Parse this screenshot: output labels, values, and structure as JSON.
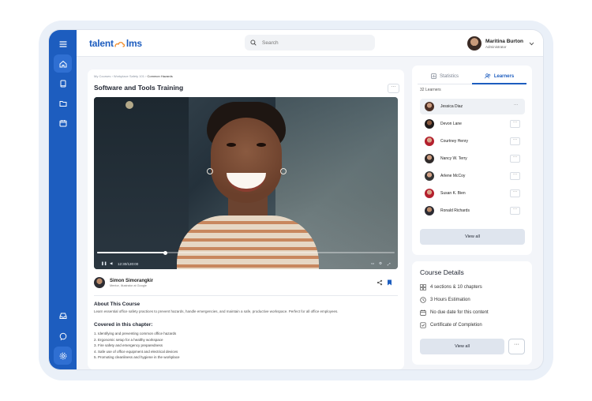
{
  "app": {
    "logo_left": "talent",
    "logo_right": "lms"
  },
  "search": {
    "placeholder": "Search"
  },
  "user": {
    "name": "Maritina Burton",
    "role": "Administrator"
  },
  "breadcrumbs": [
    "My Courses",
    "Workplace Safety 101",
    "Common Hazards"
  ],
  "course": {
    "title": "Software and Tools Training"
  },
  "video": {
    "time": "12:30/120:00",
    "progress": 0.23
  },
  "instructor": {
    "name": "Simon Simorangkir",
    "role": "Mentor, Illustrator at Google"
  },
  "about": {
    "heading": "About This Course",
    "text": "Learn essential office safety practices to prevent hazards, handle emergencies, and maintain a safe, productive workspace. Perfect for all office employees."
  },
  "covered": {
    "heading": "Covered in this chapter:",
    "items": [
      "1. Identifying and preventing common office hazards",
      "2. Ergonomic setup for a healthy workspace",
      "3. Fire safety and emergency preparedness",
      "4. Safe use of office equipment and electrical devices",
      "5. Promoting cleanliness and hygiene in the workplace"
    ]
  },
  "tabs": {
    "statistics": "Statistics",
    "learners": "Learners"
  },
  "learners": {
    "count": "32 Learners",
    "list": [
      "Jessica Diaz",
      "Devon Lane",
      "Courtney Henry",
      "Nancy W. Terry",
      "Arlene McCoy",
      "Susan K. Bien",
      "Ronald Richards"
    ],
    "view_all": "View all"
  },
  "details": {
    "heading": "Course Details",
    "items": [
      "4 sections & 10 chapters",
      "3 Hours Estimation",
      "No due date for this content",
      "Certificate of Completion"
    ],
    "view_all": "View all"
  },
  "colors": {
    "brand": "#1d5dbf",
    "sidebar_active": "#2f6fd2"
  }
}
